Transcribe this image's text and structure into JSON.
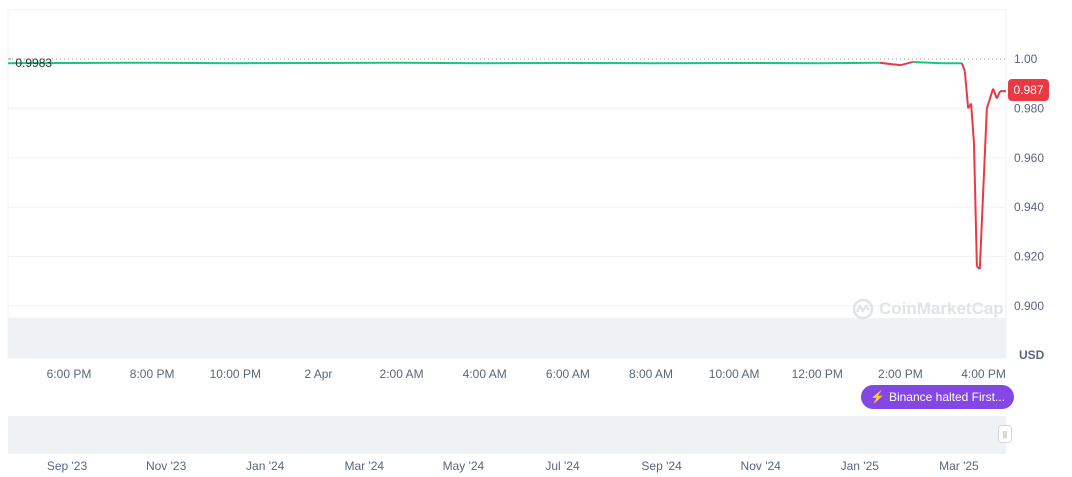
{
  "chart_data": {
    "type": "line",
    "title": "",
    "ylabel": "USD",
    "ylim": [
      0.89,
      1.005
    ],
    "yticks": [
      "1.00",
      "0.980",
      "0.960",
      "0.940",
      "0.920",
      "0.900"
    ],
    "ytick_values": [
      1.0,
      0.98,
      0.96,
      0.94,
      0.92,
      0.9
    ],
    "xticks": [
      "6:00 PM",
      "8:00 PM",
      "10:00 PM",
      "2 Apr",
      "2:00 AM",
      "4:00 AM",
      "6:00 AM",
      "8:00 AM",
      "10:00 AM",
      "12:00 PM",
      "2:00 PM",
      "4:00 PM"
    ],
    "xtick_hours": [
      0,
      2,
      4,
      6,
      8,
      10,
      12,
      14,
      16,
      18,
      20,
      22
    ],
    "x_hours": [
      -1.47,
      0,
      2,
      4,
      6,
      8,
      10,
      12,
      14,
      16,
      18,
      19.5,
      20,
      20.3,
      21,
      21.48,
      21.55,
      21.63,
      21.7,
      21.77,
      21.84,
      21.91,
      22.08,
      22.23,
      22.32,
      22.4,
      22.54
    ],
    "y": [
      0.9983,
      0.9984,
      0.9985,
      0.9983,
      0.9984,
      0.9985,
      0.9983,
      0.9984,
      0.9983,
      0.9984,
      0.9983,
      0.9985,
      0.9975,
      0.9988,
      0.9983,
      0.9983,
      0.995,
      0.98,
      0.982,
      0.966,
      0.916,
      0.915,
      0.98,
      0.988,
      0.984,
      0.987,
      0.987
    ],
    "reference_value": "0.9983",
    "current_price": "0.987",
    "colors": {
      "up": "#16c784",
      "down": "#ea3943"
    },
    "event": "Binance halted First...",
    "watermark": "CoinMarketCap",
    "navigator_labels": [
      "Sep '23",
      "Nov '23",
      "Jan '24",
      "Mar '24",
      "May '24",
      "Jul '24",
      "Sep '24",
      "Nov '24",
      "Jan '25",
      "Mar '25"
    ]
  }
}
